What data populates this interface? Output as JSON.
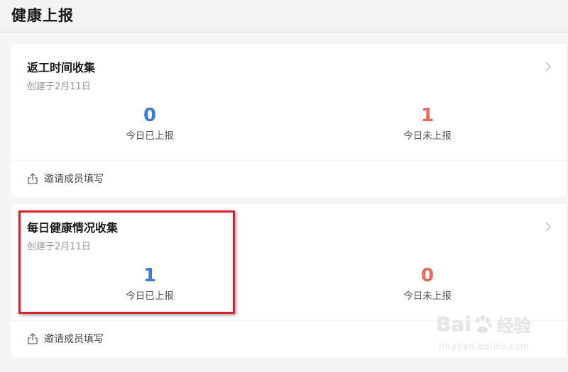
{
  "header": {
    "title": "健康上报"
  },
  "cards": [
    {
      "title": "返工时间收集",
      "subtitle": "创建于2月11日",
      "reported_value": "0",
      "reported_label": "今日已上报",
      "unreported_value": "1",
      "unreported_label": "今日未上报",
      "invite_label": "邀请成员填写"
    },
    {
      "title": "每日健康情况收集",
      "subtitle": "创建于2月11日",
      "reported_value": "1",
      "reported_label": "今日已上报",
      "unreported_value": "0",
      "unreported_label": "今日未上报",
      "invite_label": "邀请成员填写"
    }
  ],
  "watermark": {
    "brand_pre": "Bai",
    "brand_post": "经验",
    "url": "jingyan.baidu.com"
  },
  "colors": {
    "reported": "#3a7bd5",
    "unreported": "#f2645a",
    "highlight": "#d8212a",
    "background": "#f4f4f4"
  },
  "icons": {
    "card_arrow": "chevron-right-icon",
    "invite": "share-icon",
    "watermark": "baidu-paw-icon"
  }
}
